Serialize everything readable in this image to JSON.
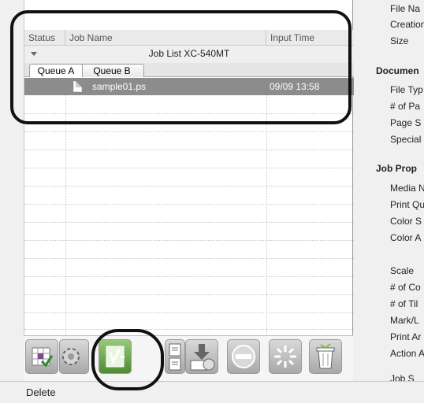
{
  "columns": {
    "status": "Status",
    "job_name": "Job Name",
    "input_time": "Input Time"
  },
  "group": {
    "title": "Job List XC-540MT"
  },
  "tabs": [
    {
      "label": "Queue A"
    },
    {
      "label": "Queue B"
    }
  ],
  "rows": [
    {
      "name": "sample01.ps",
      "time": "09/09 13:58"
    }
  ],
  "toolbar": {
    "icons": [
      "layout-icon",
      "settings-gear-icon",
      "rip-print-icon",
      "document-icon",
      "export-icon",
      "stop-icon",
      "loading-icon",
      "trash-icon"
    ]
  },
  "status": {
    "text": "Delete"
  },
  "properties": {
    "items_top": [
      "File Na",
      "Creation",
      "Size"
    ],
    "section_document": "Documen",
    "doc_items": [
      "File Typ",
      "# of Pa",
      "Page S",
      "Special"
    ],
    "section_job": "Job Prop",
    "job_items": [
      "Media N",
      "Print Qu",
      "Color S",
      "Color A"
    ],
    "job_items2": [
      "Scale",
      "# of Co",
      "# of Til",
      "Mark/L",
      "Print Ar",
      "Action A",
      "Job S"
    ]
  }
}
